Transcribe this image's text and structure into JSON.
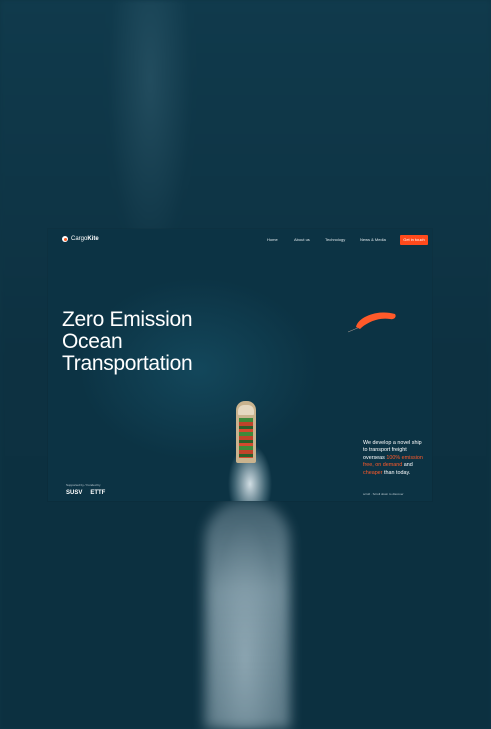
{
  "brand": {
    "name_light": "Cargo",
    "name_bold": "Kite",
    "accent": "#ff4a1c"
  },
  "nav": {
    "links": [
      "Home",
      "About us",
      "Technology",
      "News & Media"
    ],
    "cta": "Get in touch"
  },
  "hero": {
    "headline": [
      "Zero Emission",
      "Ocean",
      "Transportation"
    ],
    "tagline": {
      "part1": "We develop a novel ship to transport freight overseas",
      "accent1": "100% emission free, on demand",
      "part2": "and",
      "accent2": "cheaper",
      "part3": "than today."
    }
  },
  "footer": {
    "partners_label": "Supported by / Funded by",
    "partner_logos": [
      "SUSV",
      "ETTF"
    ],
    "right_text": "scroll  ·  Scroll down to discover"
  },
  "icons": {
    "logo": "cargokite-logo-icon",
    "kite": "kite-icon",
    "ship": "ship-icon"
  }
}
